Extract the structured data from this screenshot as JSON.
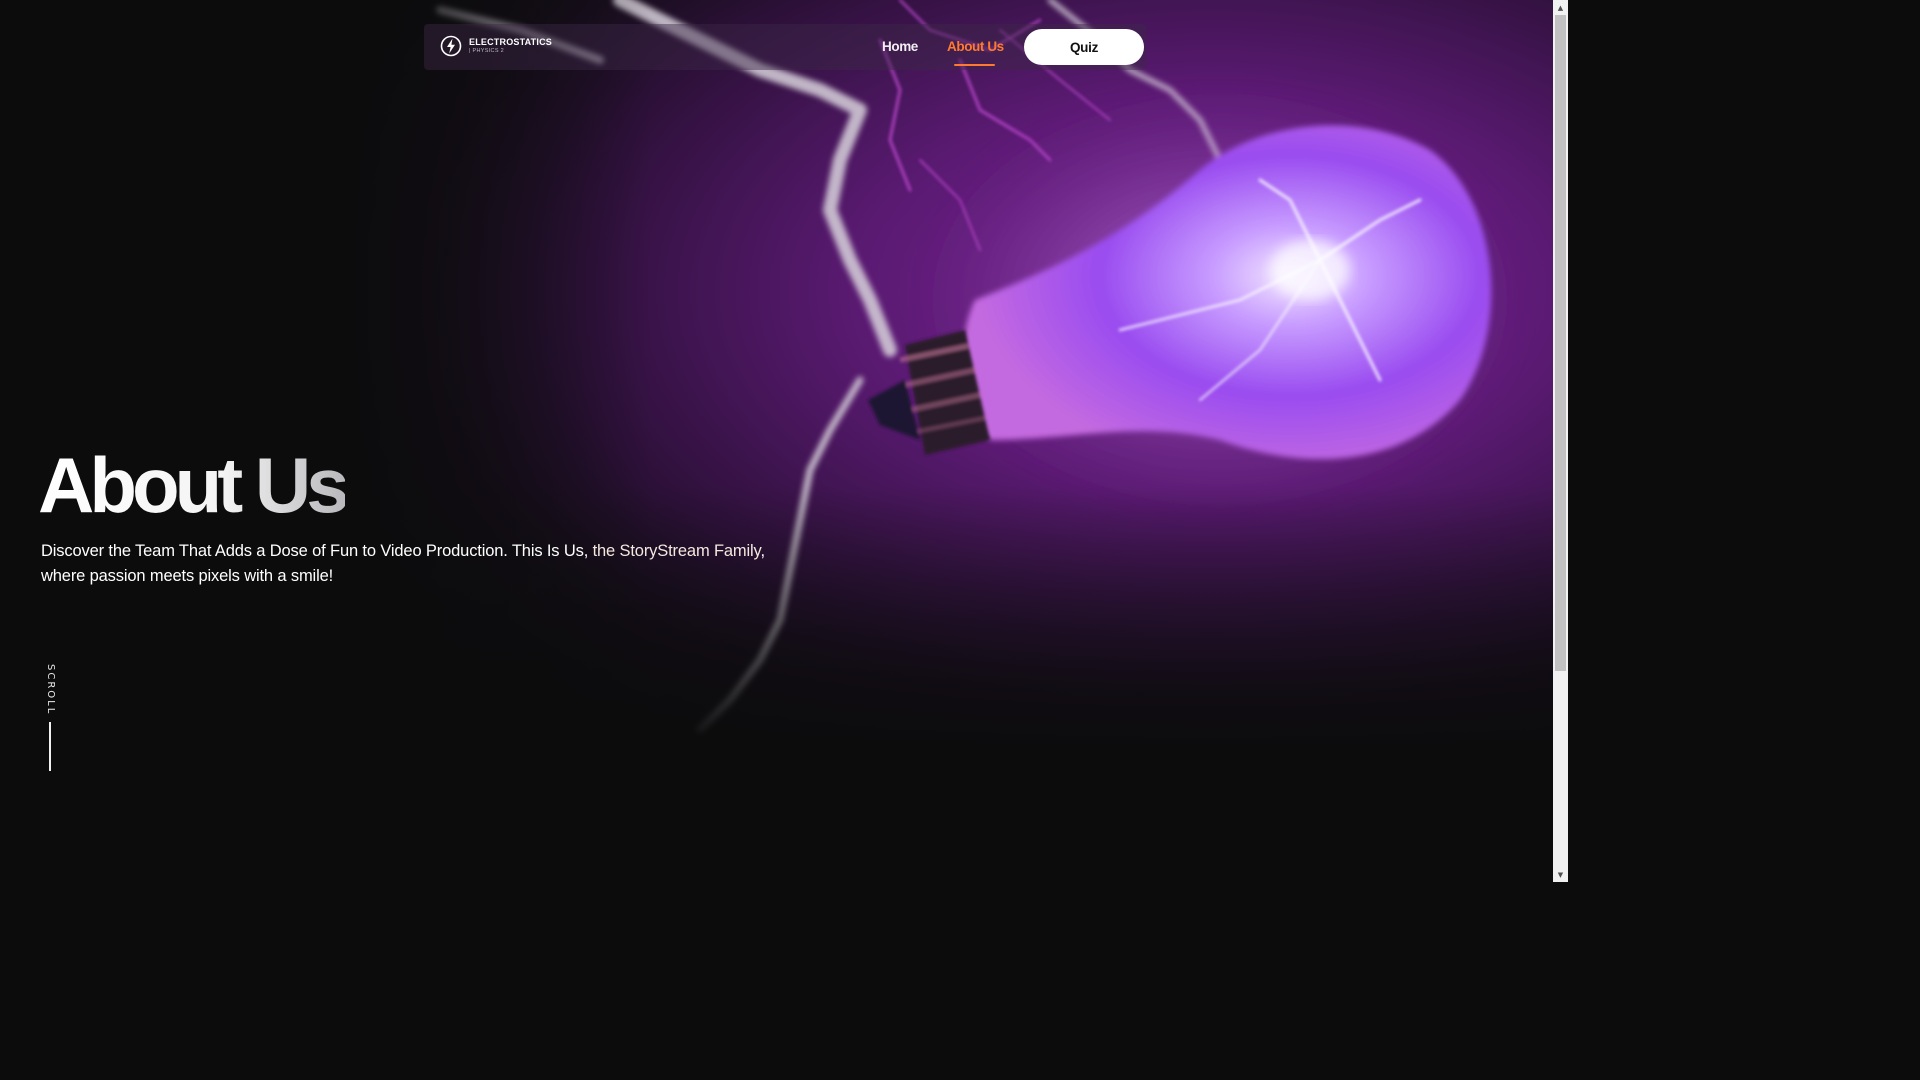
{
  "brand": {
    "title": "ELECTROSTATICS",
    "subtitle": "| PHYSICS 2",
    "icon": "lightning-bolt-icon"
  },
  "nav": {
    "home_label": "Home",
    "about_label": "About Us",
    "quiz_label": "Quiz",
    "active_item": "About Us",
    "accent_color": "#ff7a2e"
  },
  "hero": {
    "title": "About Us",
    "description_part1": "Discover the Team That Adds a Dose of Fun to Video Production. This Is Us, ",
    "description_highlight": "the StoryStream Family",
    "description_part2": ", where passion meets pixels with a smile!"
  },
  "scroll_indicator": {
    "label": "SCROLL"
  },
  "colors": {
    "background": "#0c0c0d",
    "bulb_glow": "#b070ff",
    "purple_haze": "#5a1a6e"
  }
}
